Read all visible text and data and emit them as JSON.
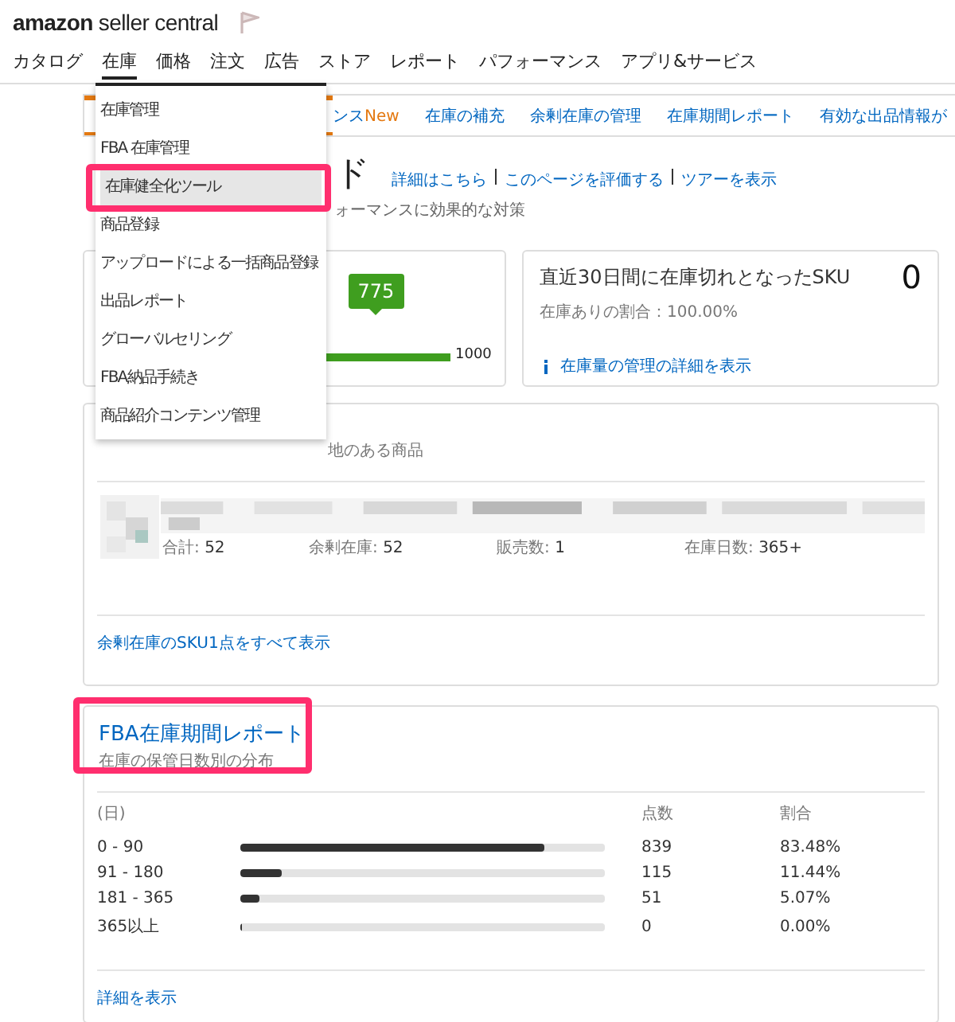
{
  "header": {
    "logo_bold": "amazon",
    "logo_text": "seller central"
  },
  "nav": [
    {
      "label": "カタログ",
      "selected": false
    },
    {
      "label": "在庫",
      "selected": true
    },
    {
      "label": "価格",
      "selected": false
    },
    {
      "label": "注文",
      "selected": false
    },
    {
      "label": "広告",
      "selected": false
    },
    {
      "label": "ストア",
      "selected": false
    },
    {
      "label": "レポート",
      "selected": false
    },
    {
      "label": "パフォーマンス",
      "selected": false
    },
    {
      "label": "アプリ&サービス",
      "selected": false
    }
  ],
  "dropdown": [
    {
      "label": "在庫管理",
      "selected": false,
      "highlighted": false
    },
    {
      "label": "FBA 在庫管理",
      "selected": false,
      "highlighted": false
    },
    {
      "label": "在庫健全化ツール",
      "selected": true,
      "highlighted": true
    },
    {
      "label": "商品登録",
      "selected": false,
      "highlighted": false
    },
    {
      "label": "アップロードによる一括商品登録",
      "selected": false,
      "highlighted": false
    },
    {
      "label": "出品レポート",
      "selected": false,
      "highlighted": false
    },
    {
      "label": "グローバルセリング",
      "selected": false,
      "highlighted": false
    },
    {
      "label": "FBA納品手続き",
      "selected": false,
      "highlighted": false
    },
    {
      "label": "商品紹介コンテンツ管理",
      "selected": false,
      "highlighted": false
    }
  ],
  "tabs": [
    {
      "selected": true
    },
    {
      "label": "ンス",
      "badge": "New",
      "selected": false
    },
    {
      "label": "在庫の補充",
      "selected": false
    },
    {
      "label": "余剰在庫の管理",
      "selected": false
    },
    {
      "label": "在庫期間レポート",
      "selected": false
    },
    {
      "label": "有効な出品情報が",
      "selected": false
    }
  ],
  "page": {
    "title": "ド",
    "links": [
      "詳細はこちら",
      "このページを評価する",
      "ツアーを表示"
    ],
    "subtitle": "ォーマンスに効果的な対策"
  },
  "gauge_card": {
    "value": "775",
    "max": "1000",
    "level": 0.775
  },
  "stockout_card": {
    "title": "直近30日間に在庫切れとなったSKU",
    "count": "0",
    "subtitle": "在庫ありの割合：100.00%",
    "link": "在庫量の管理の詳細を表示"
  },
  "excess_card": {
    "subtitle": "地のある商品",
    "product": {
      "kind": "picture",
      "stats": [
        {
          "label": "合計:",
          "value": "52"
        },
        {
          "label": "余剰在庫:",
          "value": "52"
        },
        {
          "label": "販売数:",
          "value": "1"
        },
        {
          "label": "在庫日数:",
          "value": "365+"
        }
      ]
    },
    "link": "余剰在庫のSKU1点をすべて表示"
  },
  "age_report": {
    "title": "FBA在庫期間レポート",
    "subtitle": "在庫の保管日数別の分布",
    "highlighted": true,
    "columns": [
      "(日)",
      "点数",
      "割合"
    ],
    "rows": [
      {
        "range": "0 - 90",
        "level": 0.8348,
        "count": "839",
        "share": "83.48%"
      },
      {
        "range": "91 - 180",
        "level": 0.1144,
        "count": "115",
        "share": "11.44%"
      },
      {
        "range": "181 - 365",
        "level": 0.0507,
        "count": "51",
        "share": "5.07%"
      },
      {
        "range": "365以上",
        "level": 0.0,
        "count": "0",
        "share": "0.00%"
      }
    ],
    "link": "詳細を表示"
  }
}
